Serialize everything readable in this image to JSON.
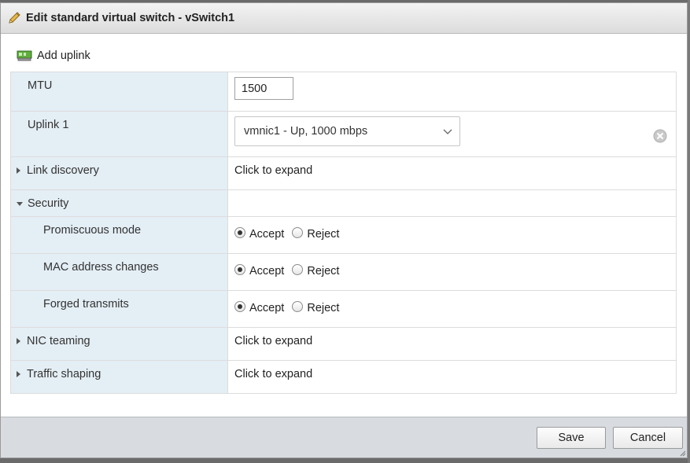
{
  "dialog": {
    "title": "Edit standard virtual switch - vSwitch1"
  },
  "toolbar": {
    "add_uplink_label": "Add uplink"
  },
  "settings": {
    "mtu": {
      "label": "MTU",
      "value": "1500"
    },
    "uplink1": {
      "label": "Uplink 1",
      "selected": "vmnic1 - Up, 1000 mbps"
    },
    "link_discovery": {
      "label": "Link discovery",
      "value": "Click to expand"
    },
    "security": {
      "label": "Security",
      "rows": [
        {
          "label": "Promiscuous mode",
          "accept": "Accept",
          "reject": "Reject",
          "selected": "Accept"
        },
        {
          "label": "MAC address changes",
          "accept": "Accept",
          "reject": "Reject",
          "selected": "Accept"
        },
        {
          "label": "Forged transmits",
          "accept": "Accept",
          "reject": "Reject",
          "selected": "Accept"
        }
      ]
    },
    "nic_teaming": {
      "label": "NIC teaming",
      "value": "Click to expand"
    },
    "traffic_shaping": {
      "label": "Traffic shaping",
      "value": "Click to expand"
    }
  },
  "footer": {
    "save_label": "Save",
    "cancel_label": "Cancel"
  },
  "colors": {
    "label_column_bg": "#e4eef5",
    "footer_bg": "#d8dbe0"
  }
}
